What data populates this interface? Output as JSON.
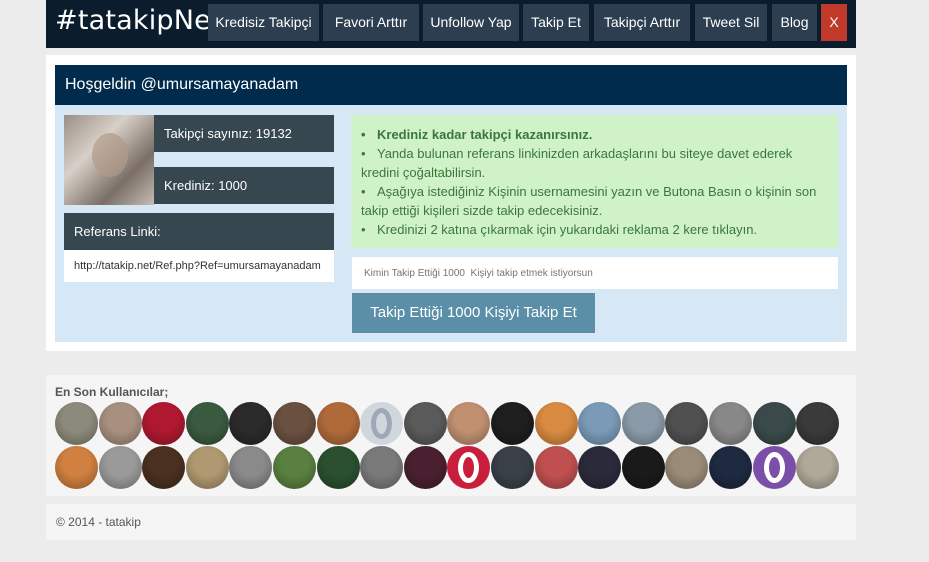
{
  "nav": {
    "brand": "#tatakipNet",
    "items": [
      {
        "label": "Kredisiz Takipçi"
      },
      {
        "label": "Favori Arttır"
      },
      {
        "label": "Unfollow Yap"
      },
      {
        "label": "Takip Et"
      },
      {
        "label": "Takipçi Arttır"
      },
      {
        "label": "Tweet Sil"
      },
      {
        "label": "Blog"
      },
      {
        "label": "X"
      }
    ]
  },
  "welcome": {
    "title": "Hoşgeldin @umursamayanadam",
    "followers": "Takipçi sayınız: 19132",
    "credits": "Krediniz: 1000",
    "referral_label": "Referans Linki:",
    "referral_url": "http://tatakip.net/Ref.php?Ref=umursamayanadam"
  },
  "info": {
    "lines": [
      "Krediniz kadar takipçi kazanırsınız.",
      "Yanda bulunan referans linkinizden arkadaşlarını bu siteye davet ederek kredini çoğaltabilirsin.",
      "Aşağıya istediğiniz Kişinin usernamesini yazın ve Butona Basın o kişinin son takip ettiği kişileri sizde takip edecekisiniz.",
      "Kredinizi 2 katına çıkarmak için yukarıdaki reklama 2 kere tıklayın."
    ],
    "bullet": "•"
  },
  "follow": {
    "placeholder": "Kimin Takip Ettiği 1000  Kişiyi takip etmek istiyorsun",
    "button": "Takip Ettiği 1000 Kişiyi Takip Et"
  },
  "users": {
    "title": "En Son Kullanıcılar;",
    "avatars": [
      {
        "color": "#8c8a7a"
      },
      {
        "color": "#a89080"
      },
      {
        "color": "#b01830"
      },
      {
        "color": "#3a5a40"
      },
      {
        "color": "#2a2a2a"
      },
      {
        "color": "#6a5040"
      },
      {
        "color": "#b06a3a"
      },
      {
        "color": "#a0a8b8",
        "style": "ring-gray"
      },
      {
        "color": "#5a5a5a"
      },
      {
        "color": "#c09070"
      },
      {
        "color": "#1e1e1e"
      },
      {
        "color": "#d88a40"
      },
      {
        "color": "#7a9ab8"
      },
      {
        "color": "#8a9aa8"
      },
      {
        "color": "#505050"
      },
      {
        "color": "#888888"
      },
      {
        "color": "#3a4a4a"
      },
      {
        "color": "#3a3a3a"
      },
      {
        "color": "#d08040"
      },
      {
        "color": "#9a9a9a"
      },
      {
        "color": "#4a3020"
      },
      {
        "color": "#b09870"
      },
      {
        "color": "#8a8a8a"
      },
      {
        "color": "#5a8040"
      },
      {
        "color": "#2a5030"
      },
      {
        "color": "#7a7a7a"
      },
      {
        "color": "#4a2030"
      },
      {
        "color": "#c81e3c",
        "style": "ring-red"
      },
      {
        "color": "#3a4048"
      },
      {
        "color": "#c05050"
      },
      {
        "color": "#2a2a3a"
      },
      {
        "color": "#1a1a1a"
      },
      {
        "color": "#9a8a78"
      },
      {
        "color": "#1e2a40"
      },
      {
        "color": "#7b4fa8",
        "style": "ring-purple"
      },
      {
        "color": "#b0a898"
      }
    ]
  },
  "footer": {
    "text": "© 2014 - tatakip"
  }
}
